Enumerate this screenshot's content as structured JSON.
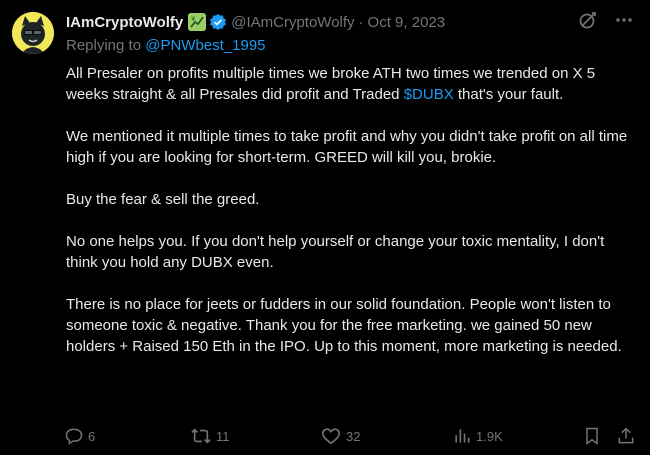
{
  "tweet": {
    "author": {
      "display_name": "IAmCryptoWolfy",
      "handle": "@IAmCryptoWolfy",
      "badge_emoji": "chart-increasing-with-yen-emoji",
      "verified_color": "#1d9bf0"
    },
    "separator": "·",
    "date": "Oct 9, 2023",
    "reply_prefix": "Replying to ",
    "reply_to": "@PNWbest_1995",
    "paragraphs": [
      {
        "before": "All Presaler on profits multiple times we broke ATH two times we trended on X 5 weeks straight & all Presales did profit and Traded ",
        "cashtag": "$DUBX",
        "after": " that's your fault."
      },
      {
        "text": "We mentioned it multiple times to take profit and why you didn't take profit on all time high if you are looking for short-term. GREED will kill you, brokie."
      },
      {
        "text": "Buy the fear & sell the greed."
      },
      {
        "text": "No one helps you. If you don't help yourself or change your toxic mentality, I don't think you hold any DUBX even."
      },
      {
        "text": "There is no place for jeets or fudders in our solid foundation. People won't listen to someone toxic & negative. Thank you for the free marketing. we gained 50 new holders + Raised 150 Eth in the IPO. Up to this moment, more marketing is needed."
      }
    ],
    "actions": {
      "replies": "6",
      "retweets": "11",
      "likes": "32",
      "views": "1.9K"
    }
  },
  "colors": {
    "background": "#000000",
    "text": "#e7e9ea",
    "secondary": "#71767b",
    "link": "#1d9bf0",
    "avatar_bg": "#f2e75a"
  },
  "icons": {
    "grok": "grok-icon",
    "more": "more-icon",
    "reply": "reply-icon",
    "retweet": "retweet-icon",
    "like": "heart-icon",
    "views": "views-icon",
    "bookmark": "bookmark-icon",
    "share": "share-icon"
  }
}
